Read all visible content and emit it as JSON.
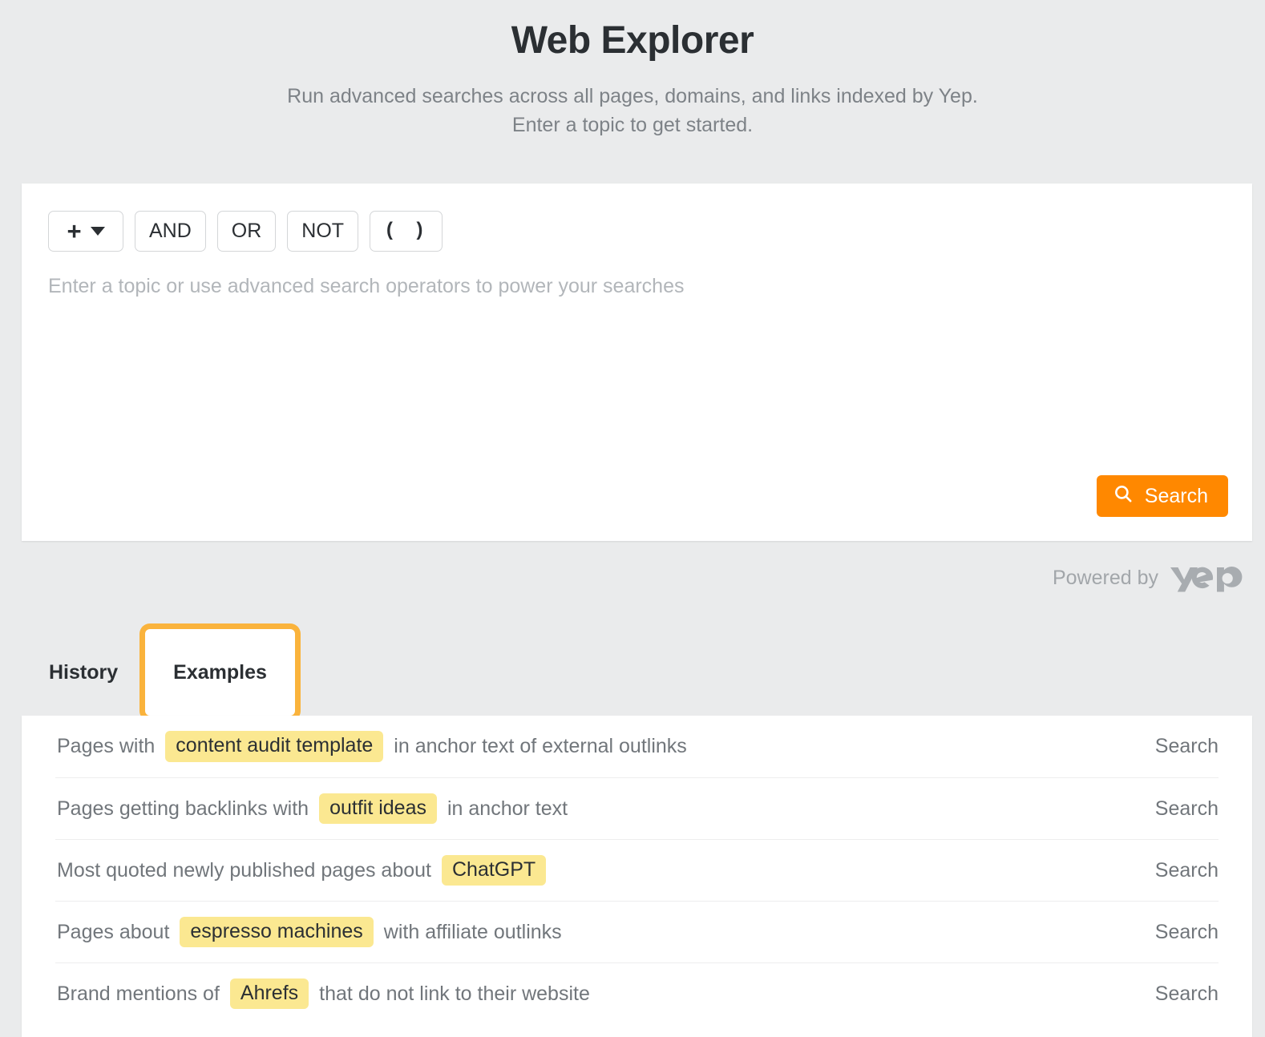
{
  "header": {
    "title": "Web Explorer",
    "subtitle_line1": "Run advanced searches across all pages, domains, and links indexed by Yep.",
    "subtitle_line2": "Enter a topic to get started."
  },
  "search_card": {
    "operators": [
      {
        "name": "add-operator",
        "label": "+",
        "has_caret": true
      },
      {
        "name": "and",
        "label": "AND",
        "has_caret": false
      },
      {
        "name": "or",
        "label": "OR",
        "has_caret": false
      },
      {
        "name": "not",
        "label": "NOT",
        "has_caret": false
      },
      {
        "name": "brackets",
        "label": "( )",
        "has_caret": false
      }
    ],
    "query_value": "",
    "query_placeholder": "Enter a topic or use advanced search operators to power your searches",
    "search_button_label": "Search",
    "search_button_icon": "search-icon",
    "search_button_color": "#ff8800"
  },
  "powered_by": {
    "text": "Powered by",
    "brand": "yep",
    "color": "#a2a6aa"
  },
  "tabs": {
    "items": [
      {
        "label": "History",
        "selected": false
      },
      {
        "label": "Examples",
        "selected": true
      }
    ],
    "focus_ring_color": "#fab33c"
  },
  "examples": {
    "action_label": "Search",
    "pill_color": "#fbe891",
    "rows": [
      {
        "prefix": "Pages with",
        "pill": "content audit template",
        "suffix": "in anchor text of external outlinks",
        "action": "Search"
      },
      {
        "prefix": "Pages getting backlinks with",
        "pill": "outfit ideas",
        "suffix": "in anchor text",
        "action": "Search"
      },
      {
        "prefix": "Most quoted newly published pages about",
        "pill": "ChatGPT",
        "suffix": "",
        "action": "Search"
      },
      {
        "prefix": "Pages about",
        "pill": "espresso machines",
        "suffix": "with affiliate outlinks",
        "action": "Search"
      },
      {
        "prefix": "Brand mentions of",
        "pill": "Ahrefs",
        "suffix": "that do not link to their website",
        "action": "Search"
      }
    ]
  }
}
